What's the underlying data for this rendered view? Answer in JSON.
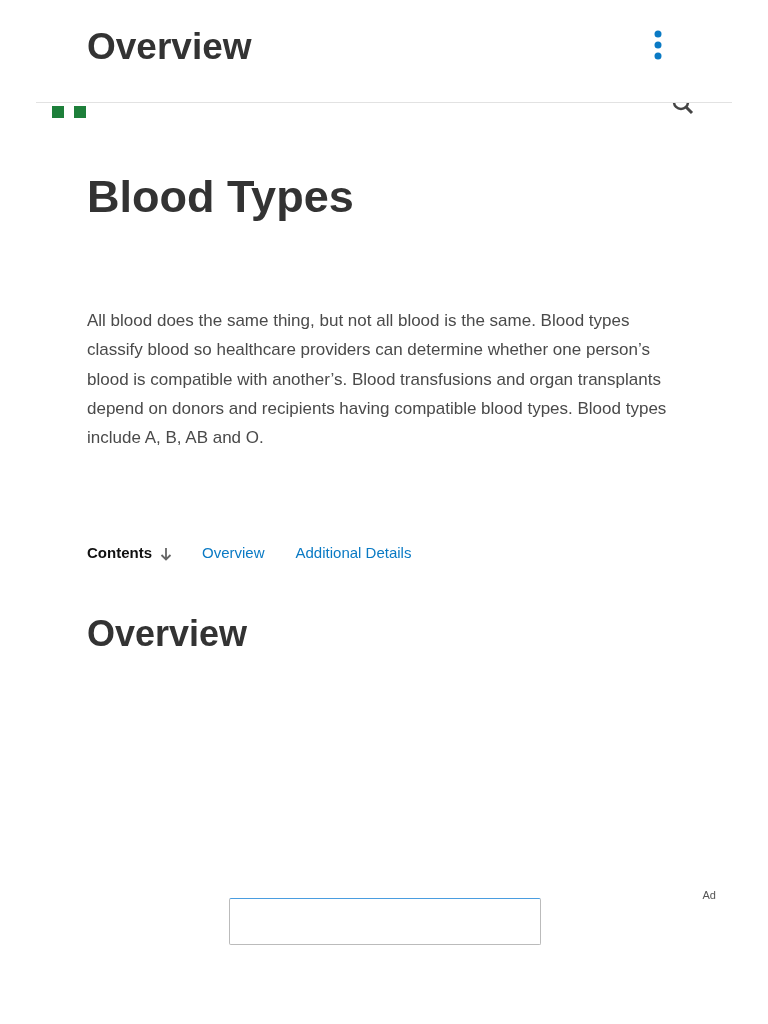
{
  "sticky_header": {
    "title": "Overview"
  },
  "article": {
    "title": "Blood Types",
    "summary": "All blood does the same thing, but not all blood is the same. Blood types classify blood so healthcare providers can determine whether one person’s blood is compatible with another’s. Blood transfusions and organ transplants depend on donors and recipients having compatible blood types. Blood types include A, B, AB and O."
  },
  "contents": {
    "label": "Contents",
    "links": [
      "Overview",
      "Additional Details"
    ]
  },
  "section": {
    "heading": "Overview"
  },
  "ad": {
    "label": "Ad"
  }
}
